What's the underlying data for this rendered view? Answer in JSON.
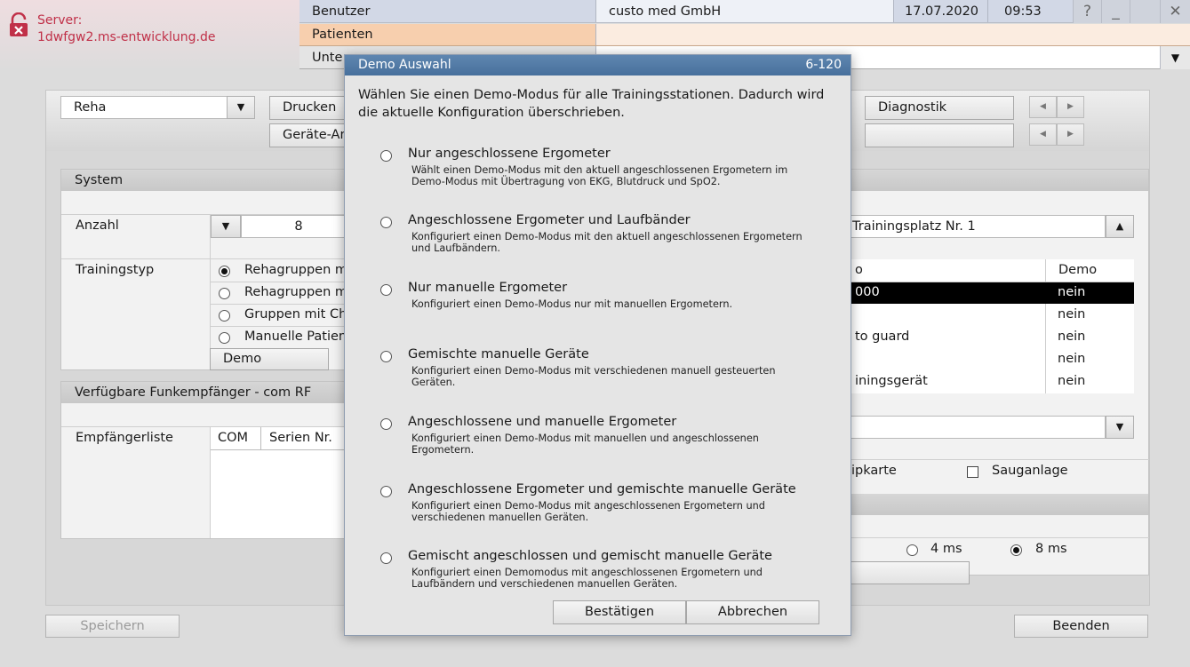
{
  "server": {
    "label": "Server:",
    "host": "1dwfgw2.ms-entwicklung.de"
  },
  "topbar": {
    "nav_user": "Benutzer",
    "company": "custo med GmbH",
    "date": "17.07.2020",
    "time": "09:53",
    "help": "?",
    "minimize": "_",
    "close": "✕",
    "nav_patients": "Patienten",
    "nav_unter": "Unte"
  },
  "toolbar": {
    "mode_select": "Reha",
    "print": "Drucken",
    "devices": "Geräte-An",
    "diagnostics": "Diagnostik"
  },
  "system_panel": {
    "title": "System",
    "count_label": "Anzahl",
    "count_value": "8",
    "training_type_label": "Trainingstyp",
    "training_options": [
      "Rehagruppen m",
      "Rehagruppen m",
      "Gruppen mit Ch",
      "Manuelle Patien"
    ],
    "demo_button": "Demo"
  },
  "rf_panel": {
    "title": "Verfügbare Funkempfänger - com RF",
    "list_label": "Empfängerliste",
    "col_com": "COM",
    "col_serial": "Serien Nr."
  },
  "right_panel": {
    "station_select": "Trainingsplatz Nr. 1",
    "col_demo": "Demo",
    "col_first": "o",
    "rows": [
      {
        "name": "000",
        "demo": "nein"
      },
      {
        "name": "",
        "demo": "nein"
      },
      {
        "name": "to guard",
        "demo": "nein"
      },
      {
        "name": "",
        "demo": "nein"
      },
      {
        "name": "iningsgerät",
        "demo": "nein"
      }
    ],
    "chip_label": "ipkarte",
    "suction_label": "Sauganlage",
    "ms4": "4 ms",
    "ms8": "8 ms"
  },
  "dialog": {
    "title": "Demo Auswahl",
    "code": "6-120",
    "intro": "Wählen Sie einen Demo-Modus für alle Trainingsstationen. Dadurch wird die aktuelle Konfiguration überschrieben.",
    "options": [
      {
        "title": "Nur angeschlossene Ergometer",
        "desc": "Wählt einen Demo-Modus mit den aktuell angeschlossenen Ergometern im Demo-Modus mit Übertragung von EKG, Blutdruck und SpO2."
      },
      {
        "title": "Angeschlossene Ergometer und Laufbänder",
        "desc": "Konfiguriert einen Demo-Modus mit den aktuell angeschlossenen Ergometern und Laufbändern."
      },
      {
        "title": "Nur manuelle Ergometer",
        "desc": "Konfiguriert einen Demo-Modus nur mit manuellen Ergometern."
      },
      {
        "title": "Gemischte manuelle Geräte",
        "desc": "Konfiguriert einen Demo-Modus mit verschiedenen manuell gesteuerten Geräten."
      },
      {
        "title": "Angeschlossene und manuelle Ergometer",
        "desc": "Konfiguriert einen Demo-Modus mit manuellen und angeschlossenen Ergometern."
      },
      {
        "title": "Angeschlossene Ergometer und gemischte manuelle Geräte",
        "desc": "Konfiguriert einen Demo-Modus mit angeschlossenen Ergometern und verschiedenen manuellen Geräten."
      },
      {
        "title": "Gemischt angeschlossen und gemischt manuelle Geräte",
        "desc": "Konfiguriert einen Demomodus mit angeschlossenen Ergometern und Laufbändern und verschiedenen manuellen Geräten."
      }
    ],
    "confirm": "Bestätigen",
    "cancel": "Abbrechen"
  },
  "footer": {
    "save": "Speichern",
    "exit": "Beenden"
  }
}
